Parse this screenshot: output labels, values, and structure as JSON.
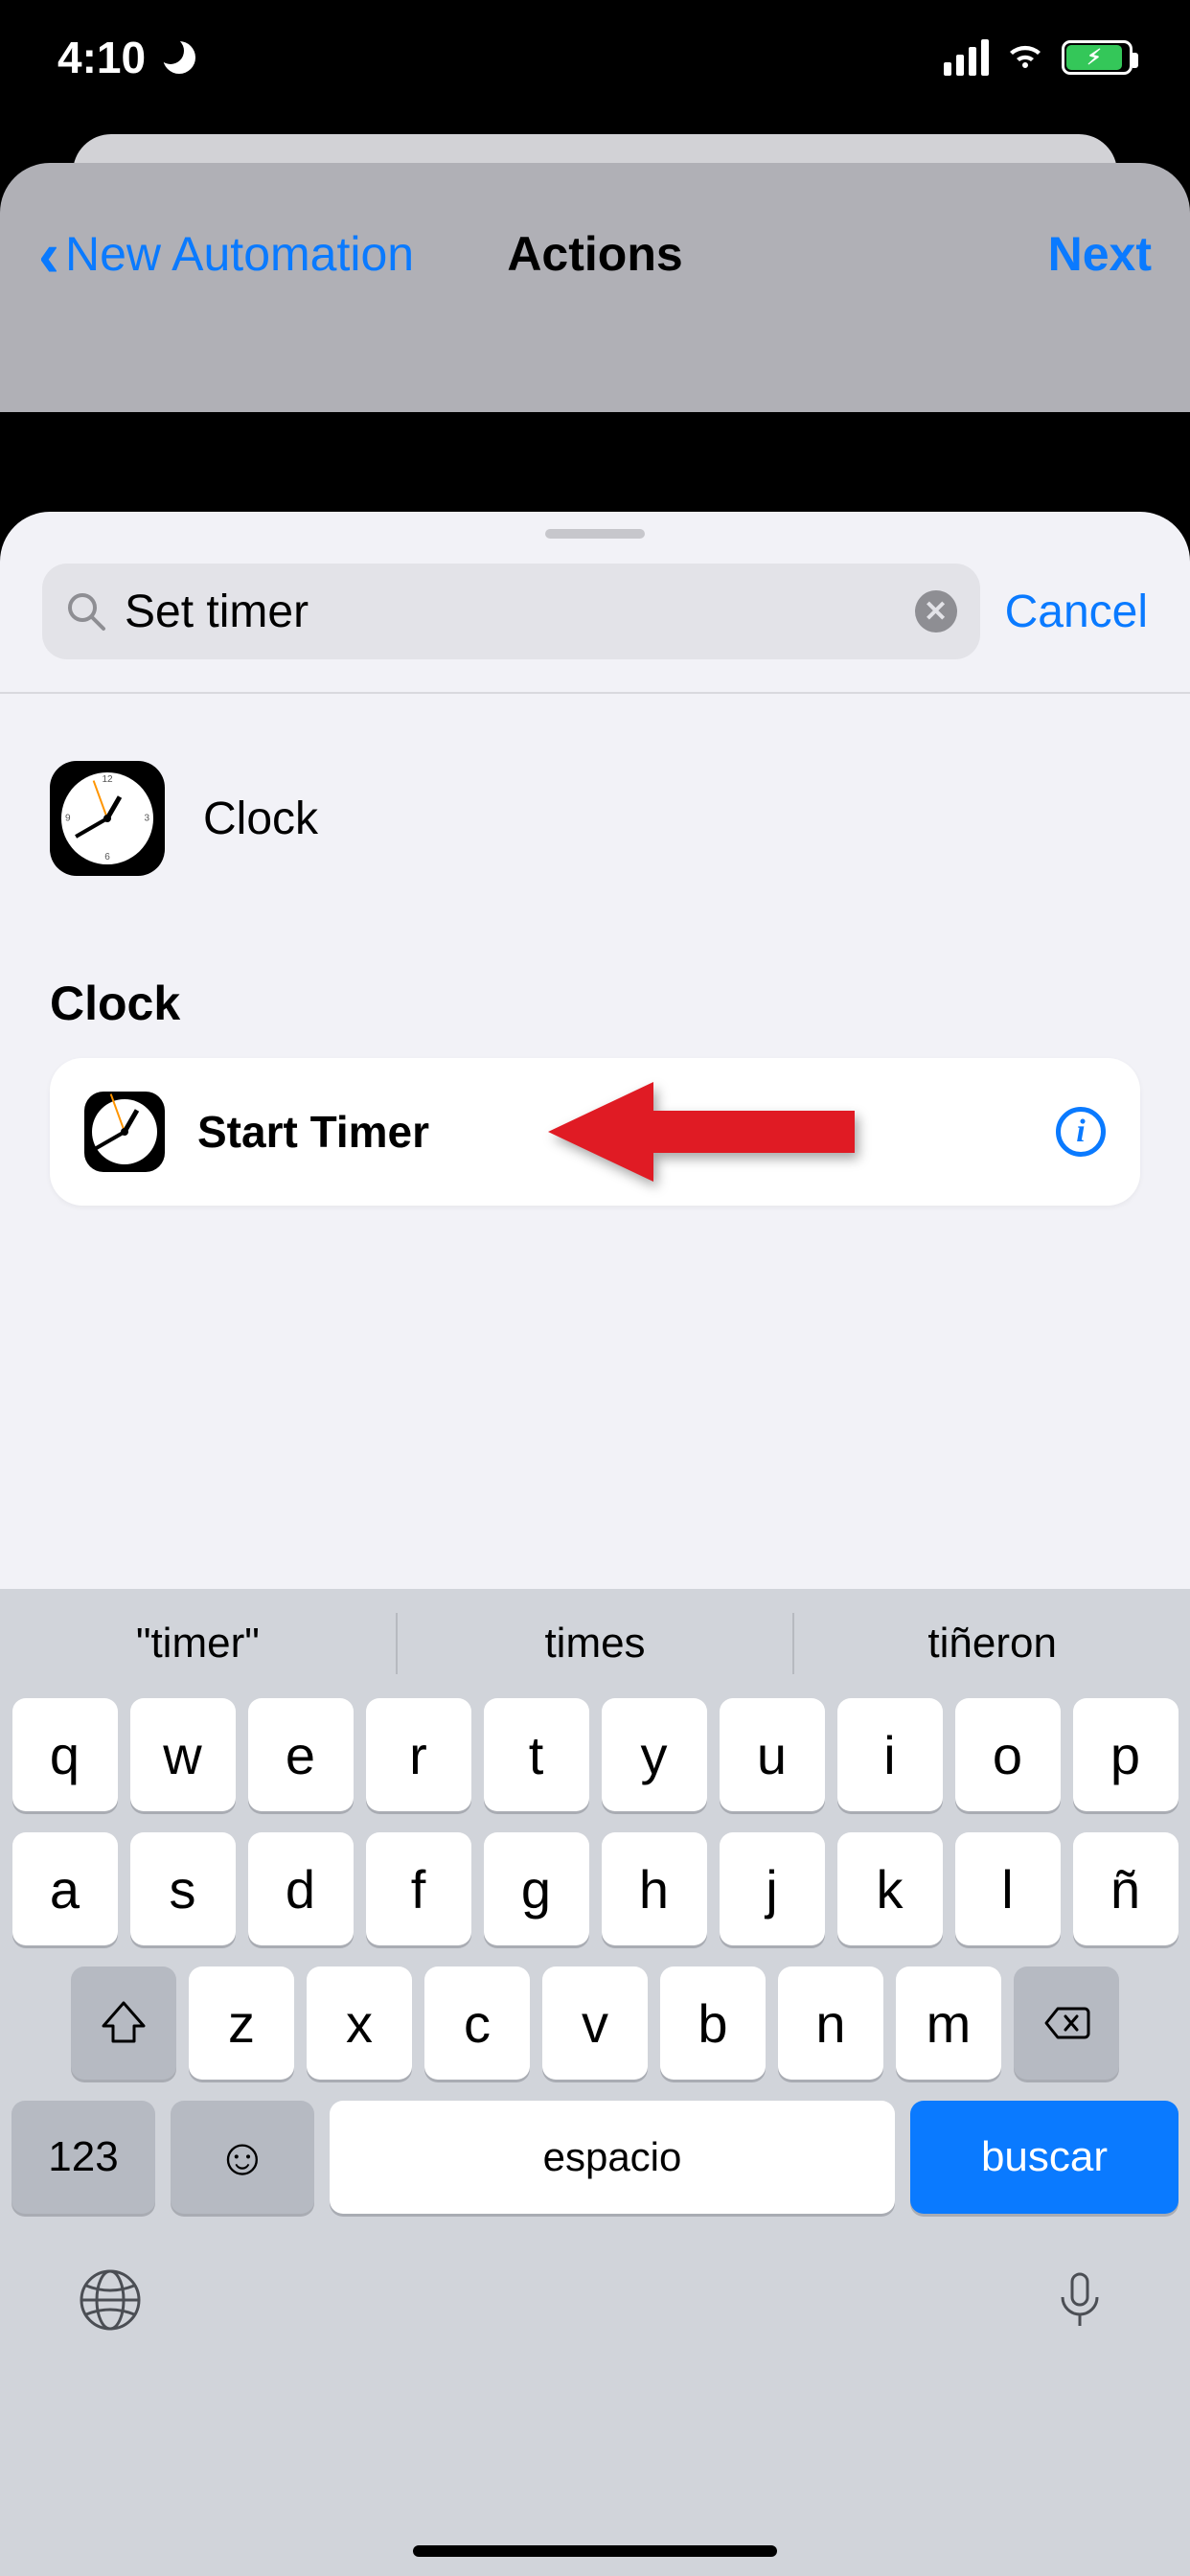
{
  "status": {
    "time": "4:10"
  },
  "nav": {
    "back": "New Automation",
    "title": "Actions",
    "next": "Next"
  },
  "search": {
    "query": "Set timer",
    "cancel": "Cancel"
  },
  "app_hit": {
    "name": "Clock"
  },
  "section": {
    "title": "Clock"
  },
  "action": {
    "title": "Start Timer"
  },
  "predictions": [
    "\"timer\"",
    "times",
    "tiñeron"
  ],
  "keys": {
    "row1": [
      "q",
      "w",
      "e",
      "r",
      "t",
      "y",
      "u",
      "i",
      "o",
      "p"
    ],
    "row2": [
      "a",
      "s",
      "d",
      "f",
      "g",
      "h",
      "j",
      "k",
      "l",
      "ñ"
    ],
    "row3": [
      "z",
      "x",
      "c",
      "v",
      "b",
      "n",
      "m"
    ],
    "numbers": "123",
    "space": "espacio",
    "search": "buscar"
  }
}
